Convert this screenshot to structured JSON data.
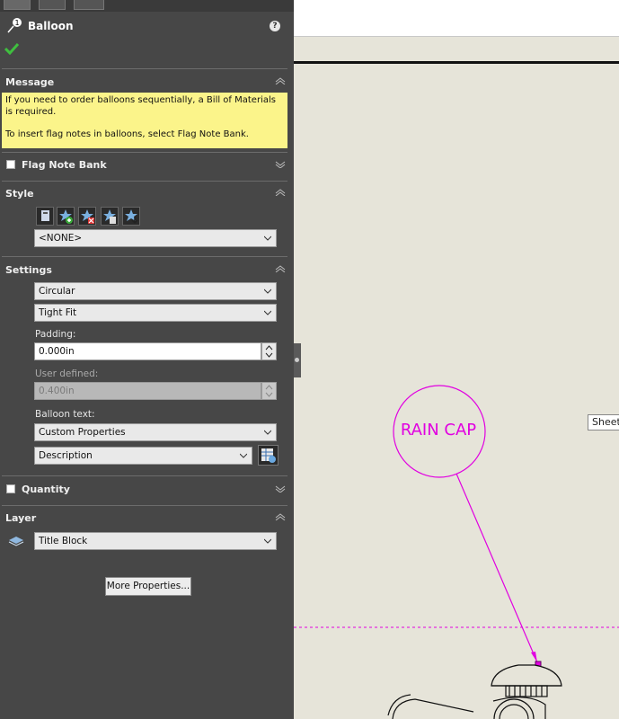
{
  "panel": {
    "title": "Balloon",
    "help_icon": "?",
    "message": {
      "title": "Message",
      "line1": "If you need to order balloons sequentially, a Bill of Materials is required.",
      "line2": "To insert flag notes in balloons, select Flag Note Bank."
    },
    "flag_note_bank": {
      "label": "Flag Note Bank",
      "checked": false
    },
    "style": {
      "title": "Style",
      "selected": "<NONE>"
    },
    "settings": {
      "title": "Settings",
      "shape": "Circular",
      "fit": "Tight Fit",
      "padding_label": "Padding:",
      "padding_value": "0.000in",
      "user_defined_label": "User defined:",
      "user_defined_value": "0.400in",
      "balloon_text_label": "Balloon text:",
      "balloon_text_value": "Custom Properties",
      "property_value": "Description"
    },
    "quantity": {
      "label": "Quantity",
      "checked": false
    },
    "layer": {
      "title": "Layer",
      "value": "Title Block"
    },
    "more_properties_button": "More Properties..."
  },
  "canvas": {
    "balloon_text": "RAIN CAP",
    "tooltip": "Sheet",
    "colors": {
      "balloon": "#e100e1",
      "background": "#e6e4d9",
      "panel": "#474747",
      "message": "#fbf48a"
    }
  }
}
